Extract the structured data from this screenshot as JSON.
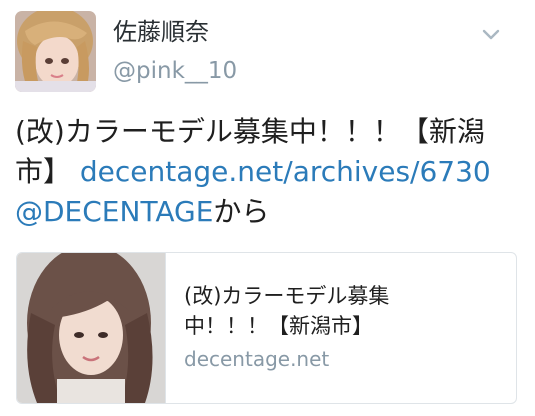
{
  "tweet": {
    "author_name": "佐藤順奈",
    "author_handle": "@pink__10",
    "menu_icon": "chevron-down-icon",
    "text_prefix": "(改)カラーモデル募集中！！！【新潟市】 ",
    "link_url": "decentage.net/archives/6730",
    "newline_space": " ",
    "mention": "@DECENTAGE",
    "text_suffix": "から"
  },
  "card": {
    "title_line1": "(改)カラーモデル募集",
    "title_line2": "中！！！【新潟市】",
    "domain": "decentage.net"
  },
  "colors": {
    "link": "#2b7bb9",
    "muted": "#8899a6",
    "text": "#1f1f1f",
    "border": "#dfe4e8"
  }
}
